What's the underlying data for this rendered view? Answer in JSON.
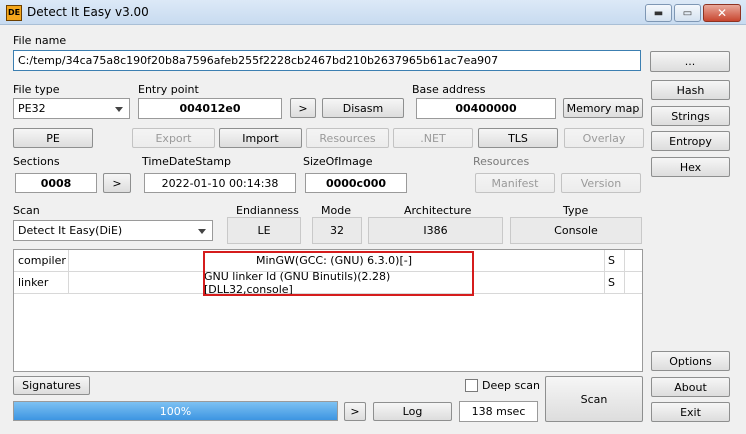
{
  "window": {
    "title": "Detect It Easy v3.00",
    "icon_text": "DE",
    "minimize_icon": "minimize-icon",
    "maximize_icon": "maximize-icon",
    "close_icon": "close-icon",
    "minimize_glyph": "▬",
    "maximize_glyph": "▭",
    "close_glyph": "✕"
  },
  "file": {
    "label": "File name",
    "path": "C:/temp/34ca75a8c190f20b8a7596afeb255f2228cb2467bd210b2637965b61ac7ea907",
    "browse_label": "..."
  },
  "header": {
    "file_type_label": "File type",
    "file_type_value": "PE32",
    "entry_point_label": "Entry point",
    "entry_point_value": "004012e0",
    "entry_arrow": ">",
    "disasm_label": "Disasm",
    "base_address_label": "Base address",
    "base_address_value": "00400000",
    "memory_map_label": "Memory map"
  },
  "sections_buttons": {
    "pe": "PE",
    "export": "Export",
    "import": "Import",
    "resources": "Resources",
    "net": ".NET",
    "tls": "TLS",
    "overlay": "Overlay"
  },
  "info": {
    "sections_label": "Sections",
    "sections_value": "0008",
    "sections_arrow": ">",
    "timestamp_label": "TimeDateStamp",
    "timestamp_value": "2022-01-10 00:14:38",
    "size_label": "SizeOfImage",
    "size_value": "0000c000",
    "resources_label": "Resources",
    "manifest_label": "Manifest",
    "version_label": "Version"
  },
  "scan": {
    "label": "Scan",
    "engine_value": "Detect It Easy(DiE)",
    "endianness_label": "Endianness",
    "endianness_value": "LE",
    "mode_label": "Mode",
    "mode_value": "32",
    "architecture_label": "Architecture",
    "architecture_value": "I386",
    "type_label": "Type",
    "type_value": "Console"
  },
  "results": [
    {
      "type": "compiler",
      "name": "MinGW(GCC: (GNU) 6.3.0)[-]",
      "flag": "S"
    },
    {
      "type": "linker",
      "name": "GNU linker ld (GNU Binutils)(2.28)[DLL32,console]",
      "flag": "S"
    }
  ],
  "side_buttons": {
    "hash": "Hash",
    "strings": "Strings",
    "entropy": "Entropy",
    "hex": "Hex",
    "options": "Options",
    "about": "About",
    "exit": "Exit"
  },
  "bottom": {
    "signatures_label": "Signatures",
    "deep_scan_label": "Deep scan",
    "scan_label": "Scan",
    "progress_percent": 100,
    "progress_text": "100%",
    "log_arrow": ">",
    "log_label": "Log",
    "elapsed": "138 msec"
  },
  "colors": {
    "highlight_border": "#d51c1c",
    "progress_fill": "#3d95e2"
  }
}
